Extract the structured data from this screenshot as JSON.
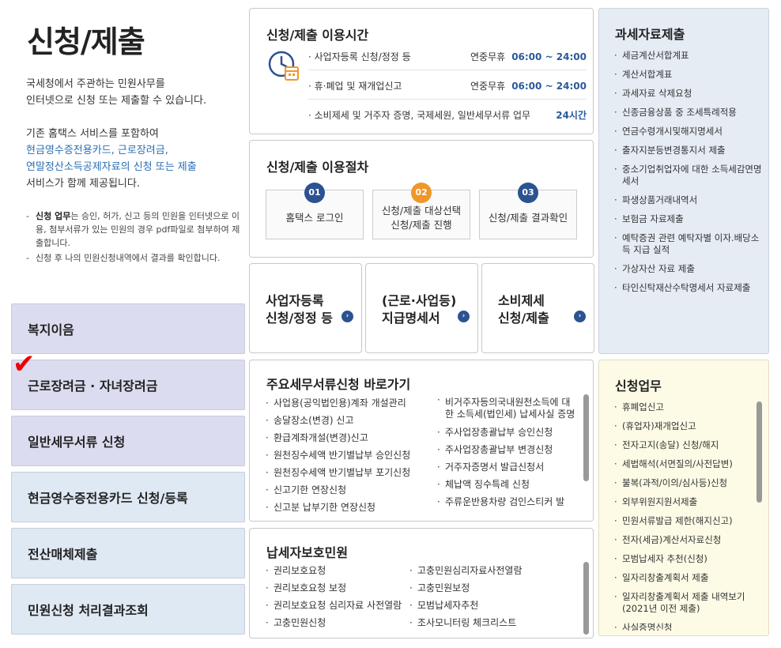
{
  "page_title": "신청/제출",
  "intro": {
    "line1": "국세청에서 주관하는 민원사무를",
    "line2": "인터넷으로 신청 또는 제출할 수 있습니다.",
    "line3": "기존 홈택스 서비스를 포함하여",
    "line4": "현금영수증전용카드, 근로장려금,",
    "line5": "연말정산소득공제자료의 신청 또는 제출",
    "line6": "서비스가 함께 제공됩니다."
  },
  "notes": {
    "note1_bold": "신청 업무",
    "note1_text": "는 승인, 허가, 신고 등의 민원을 인터넷으로 이용, 첨부서류가 있는 민원의 경우 pdf파일로 첨부하여 제출합니다.",
    "note2": "신청 후 나의 민원신청내역에서 결과를 확인합니다."
  },
  "side_menu": [
    "복지이음",
    "근로장려금 · 자녀장려금",
    "일반세무서류 신청",
    "현금영수증전용카드 신청/등록",
    "전산매체제출",
    "민원신청 처리결과조회"
  ],
  "hours": {
    "title": "신청/제출 이용시간",
    "rows": [
      {
        "label": "· 사업자등록 신청/정정 등",
        "prefix": "연중무휴",
        "time": "06:00 ~ 24:00"
      },
      {
        "label": "· 휴·폐업 및 재개업신고",
        "prefix": "연중무휴",
        "time": "06:00 ~ 24:00"
      },
      {
        "label": "· 소비제세 및 거주자 증명, 국제세원, 일반세무서류 업무",
        "prefix": "",
        "time": "24시간"
      }
    ]
  },
  "procedure": {
    "title": "신청/제출 이용절차",
    "steps": [
      {
        "num": "01",
        "line1": "홈택스 로그인",
        "line2": ""
      },
      {
        "num": "02",
        "line1": "신청/제출 대상선택",
        "line2": "신청/제출 진행"
      },
      {
        "num": "03",
        "line1": "신청/제출 결과확인",
        "line2": ""
      }
    ]
  },
  "big_buttons": [
    {
      "line1": "사업자등록",
      "line2": "신청/정정 등"
    },
    {
      "line1": "(근로·사업등)",
      "line2": "지급명세서"
    },
    {
      "line1": "소비제세",
      "line2": "신청/제출"
    }
  ],
  "shortcuts": {
    "title": "주요세무서류신청 바로가기",
    "left": [
      "사업용(공익법인용)계좌 개설관리",
      "송달장소(변경) 신고",
      "환급계좌개설(변경)신고",
      "원천징수세액 반기별납부 승인신청",
      "원천징수세액 반기별납부 포기신청",
      "신고기한 연장신청",
      "신고분 납부기한 연장신청"
    ],
    "right": [
      "비거주자등의국내원천소득에 대한 소득세(법인세) 납세사실 증명",
      "주사업장총괄납부 승인신청",
      "주사업장총괄납부 변경신청",
      "거주자증명서 발급신청서",
      "체납액 징수특례 신청",
      "주류운반용차량 검인스티커 발"
    ]
  },
  "protection": {
    "title": "납세자보호민원",
    "left": [
      "권리보호요청",
      "권리보호요청 보정",
      "권리보호요청 심리자료 사전열람",
      "고충민원신청"
    ],
    "right": [
      "고충민원심리자료사전열람",
      "고충민원보정",
      "모범납세자추천",
      "조사모니터링 체크리스트"
    ]
  },
  "tax_data": {
    "title": "과세자료제출",
    "items": [
      "세금계산서합계표",
      "계산서합계표",
      "과세자료 삭제요청",
      "신종금융상품 중 조세특례적용",
      "연금수령개시및해지명세서",
      "출자지분등변경통지서 제출",
      "중소기업취업자에 대한 소득세감면명세서",
      "파생상품거래내역서",
      "보험금 자료제출",
      "예탁증권 관련 예탁자별 이자.배당소득 지급 실적",
      "가상자산 자료 제출",
      "타인신탁재산수탁명세서 자료제출"
    ]
  },
  "apply_work": {
    "title": "신청업무",
    "items": [
      "휴폐업신고",
      "(휴업자)재개업신고",
      "전자고지(송달) 신청/해지",
      "세법해석(서면질의/사전답변)",
      "불복(과적/이의/심사등)신청",
      "외부위원지원서제출",
      "민원서류발급 제한(해지신고)",
      "전자(세금)계산서자료신청",
      "모범납세자 추천(신청)",
      "일자리창출계획서 제출",
      "일자리창출계획서 제출 내역보기(2021년 이전 제출)",
      "사실증명신청"
    ]
  },
  "colors": {
    "accent_blue": "#2b5291",
    "orange": "#f0962a",
    "check_red": "#e00000"
  }
}
